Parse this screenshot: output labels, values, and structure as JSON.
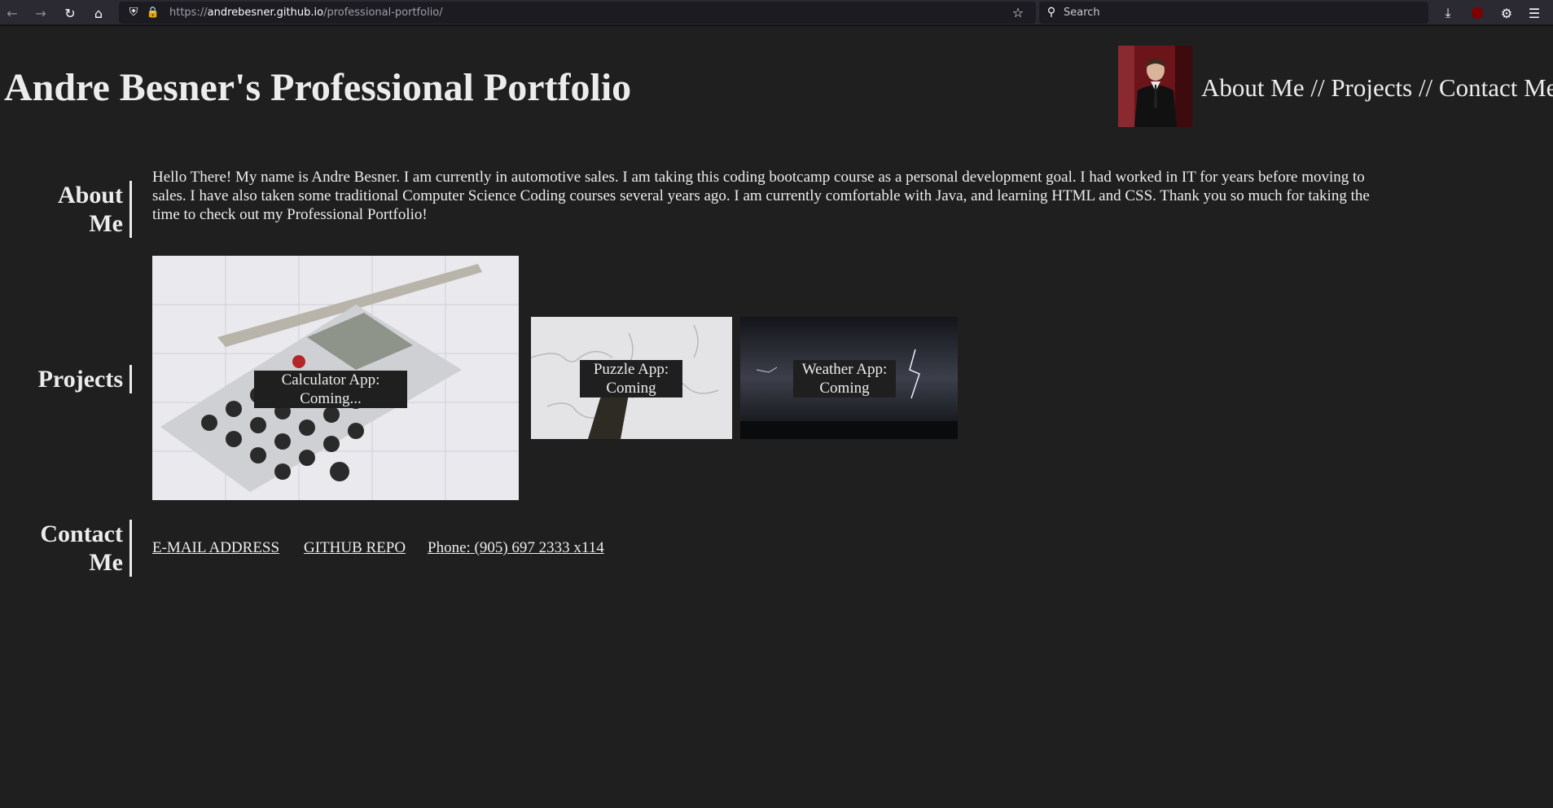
{
  "browser": {
    "url_prefix": "https://",
    "url_host": "andrebesner.github.io",
    "url_path": "/professional-portfolio/",
    "search_placeholder": "Search"
  },
  "header": {
    "title": "Andre Besner's Professional Portfolio",
    "nav": {
      "about": "About Me",
      "sep1": " // ",
      "projects": "Projects",
      "sep2": " // ",
      "contact": "Contact Me"
    }
  },
  "about": {
    "heading": "About Me",
    "text": "Hello There! My name is Andre Besner. I am currently in automotive sales. I am taking this coding bootcamp course as a personal development goal. I had worked in IT for years before moving to sales. I have also taken some traditional Computer Science Coding courses several years ago. I am currently comfortable with Java, and learning HTML and CSS. Thank you so much for taking the time to check out my Professional Portfolio!"
  },
  "projects": {
    "heading": "Projects",
    "items": [
      {
        "caption": "Calculator App: Coming..."
      },
      {
        "caption": "Puzzle App: Coming"
      },
      {
        "caption": "Weather App: Coming"
      }
    ]
  },
  "contact": {
    "heading_line1": "Contact",
    "heading_line2": "Me",
    "email": "E-MAIL ADDRESS",
    "github": "GITHUB REPO",
    "phone": "Phone: (905) 697 2333 x114"
  }
}
